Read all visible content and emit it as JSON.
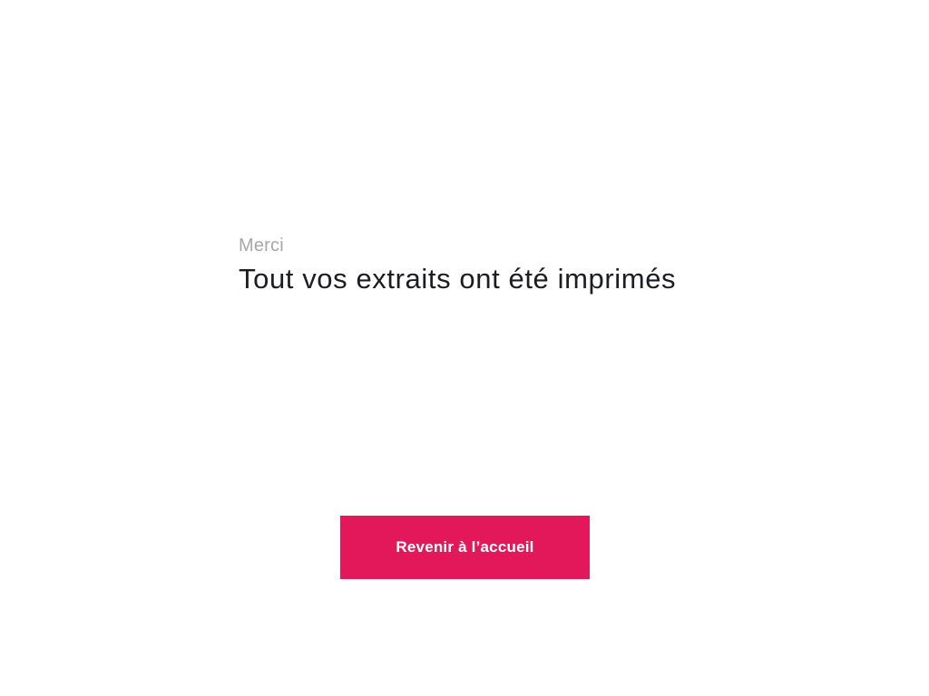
{
  "confirmation": {
    "subtitle": "Merci",
    "title": "Tout vos extraits ont été imprimés"
  },
  "actions": {
    "home_label": "Revenir à l’accueil"
  },
  "colors": {
    "accent": "#e2185a",
    "title_text": "#1c1d24",
    "subtitle_text": "#a6a6ab",
    "background": "#ffffff"
  }
}
